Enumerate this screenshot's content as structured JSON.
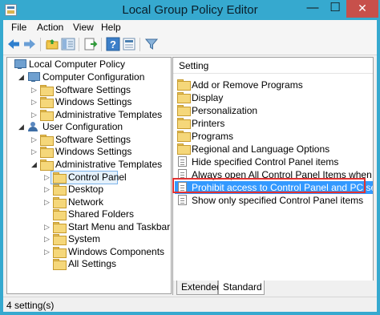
{
  "window": {
    "title": "Local Group Policy Editor",
    "controls": {
      "minimize": "—",
      "maximize": "☐",
      "close": "✕"
    }
  },
  "menu": [
    "File",
    "Action",
    "View",
    "Help"
  ],
  "toolbar": [
    "back-arrow-icon",
    "forward-arrow-icon",
    "up-folder-icon",
    "show-hide-tree-icon",
    "export-list-icon",
    "help-icon",
    "properties-icon",
    "filter-icon"
  ],
  "tree": [
    {
      "label": "Local Computer Policy",
      "icon": "computer-icon",
      "arrow": ""
    },
    {
      "label": "Computer Configuration",
      "icon": "computer-icon",
      "arrow": "◢"
    },
    {
      "label": "Software Settings",
      "icon": "folder-icon",
      "arrow": "▷"
    },
    {
      "label": "Windows Settings",
      "icon": "folder-icon",
      "arrow": "▷"
    },
    {
      "label": "Administrative Templates",
      "icon": "folder-icon",
      "arrow": "▷"
    },
    {
      "label": "User Configuration",
      "icon": "user-icon",
      "arrow": "◢"
    },
    {
      "label": "Software Settings",
      "icon": "folder-icon",
      "arrow": "▷"
    },
    {
      "label": "Windows Settings",
      "icon": "folder-icon",
      "arrow": "▷"
    },
    {
      "label": "Administrative Templates",
      "icon": "folder-icon",
      "arrow": "◢"
    },
    {
      "label": "Control Panel",
      "icon": "folder-icon",
      "arrow": "▷",
      "selected": true
    },
    {
      "label": "Desktop",
      "icon": "folder-icon",
      "arrow": "▷"
    },
    {
      "label": "Network",
      "icon": "folder-icon",
      "arrow": "▷"
    },
    {
      "label": "Shared Folders",
      "icon": "folder-icon",
      "arrow": ""
    },
    {
      "label": "Start Menu and Taskbar",
      "icon": "folder-icon",
      "arrow": "▷"
    },
    {
      "label": "System",
      "icon": "folder-icon",
      "arrow": "▷"
    },
    {
      "label": "Windows Components",
      "icon": "folder-icon",
      "arrow": "▷"
    },
    {
      "label": "All Settings",
      "icon": "folder-icon",
      "arrow": ""
    }
  ],
  "list": {
    "column_header": "Setting",
    "rows": [
      {
        "label": "Add or Remove Programs",
        "type": "folder"
      },
      {
        "label": "Display",
        "type": "folder"
      },
      {
        "label": "Personalization",
        "type": "folder"
      },
      {
        "label": "Printers",
        "type": "folder"
      },
      {
        "label": "Programs",
        "type": "folder"
      },
      {
        "label": "Regional and Language Options",
        "type": "folder"
      },
      {
        "label": "Hide specified Control Panel items",
        "type": "policy"
      },
      {
        "label": "Always open All Control Panel Items when opening",
        "type": "policy"
      },
      {
        "label": "Prohibit access to Control Panel and PC settings",
        "type": "policy",
        "selected": true
      },
      {
        "label": "Show only specified Control Panel items",
        "type": "policy"
      }
    ]
  },
  "tabs": {
    "extended": "Extended",
    "standard": "Standard"
  },
  "status": {
    "text": "4 setting(s)"
  },
  "colors": {
    "titlebar": "#36a9cf",
    "close_button": "#c7504b",
    "selection": "#3399ff",
    "highlight_box": "#e03232"
  }
}
